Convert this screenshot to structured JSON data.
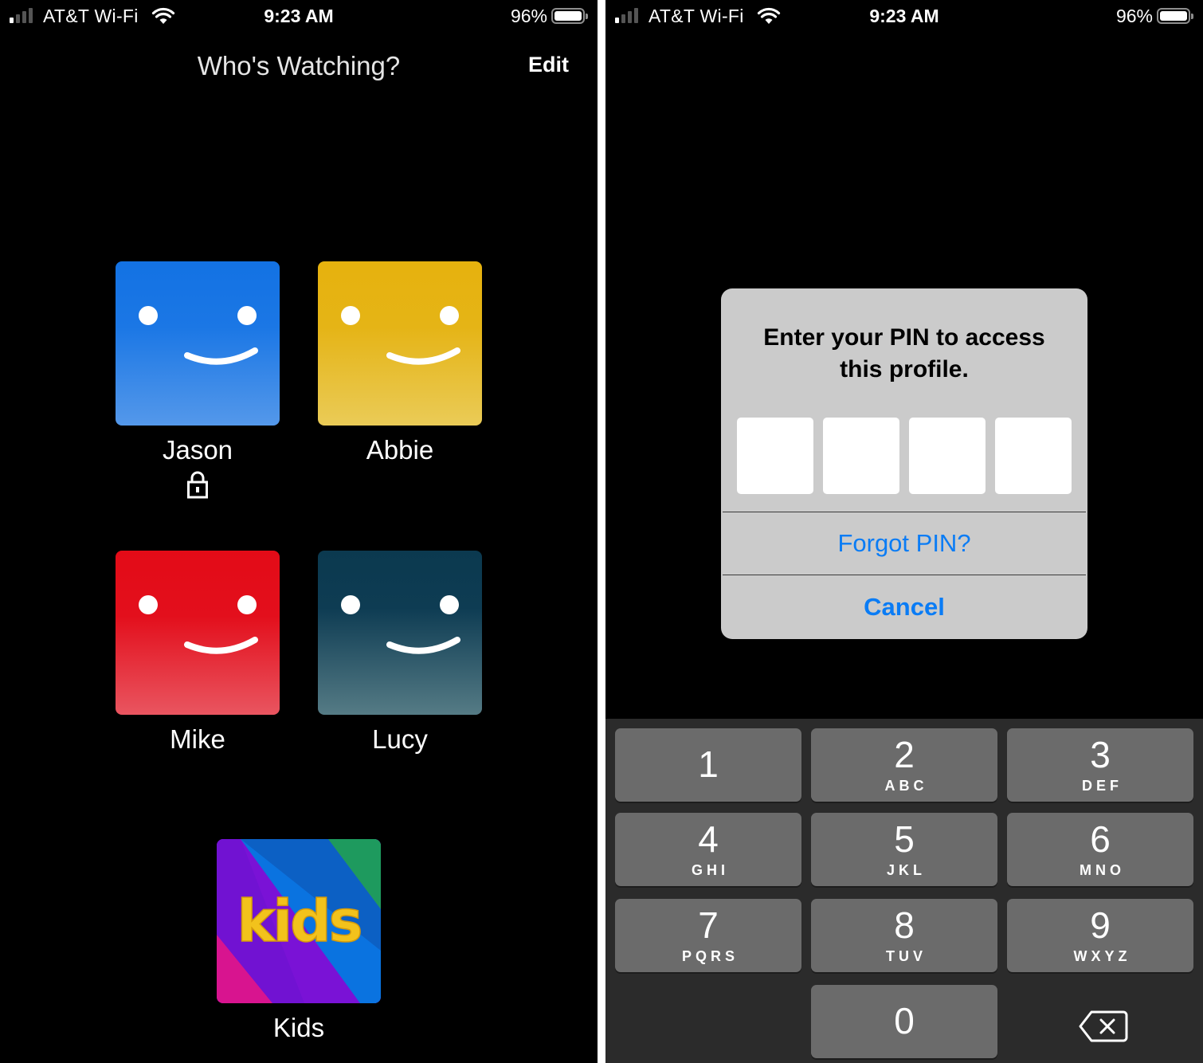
{
  "status_bar": {
    "carrier": "AT&T Wi-Fi",
    "time": "9:23 AM",
    "battery_percent": "96%",
    "battery_level": 0.96,
    "signal_bars": 1,
    "signal_bars_total": 4,
    "icons": [
      "signal-icon",
      "wifi-icon",
      "battery-icon"
    ]
  },
  "profiles_screen": {
    "title": "Who's Watching?",
    "edit_label": "Edit",
    "profiles": [
      {
        "name": "Jason",
        "color": "#1b77e5",
        "locked": true,
        "icon": "smiley-avatar"
      },
      {
        "name": "Abbie",
        "color": "#e5b416",
        "locked": false,
        "icon": "smiley-avatar"
      },
      {
        "name": "Mike",
        "color": "#e30f1c",
        "locked": false,
        "icon": "smiley-avatar"
      },
      {
        "name": "Lucy",
        "color": "#0e3c53",
        "locked": false,
        "icon": "smiley-avatar"
      },
      {
        "name": "Kids",
        "color": "#7c16d8",
        "locked": false,
        "icon": "kids-avatar",
        "avatar_text": "kids"
      }
    ]
  },
  "pin_screen": {
    "dialog": {
      "message_line1": "Enter your PIN to access",
      "message_line2": "this profile.",
      "pin_digits": [
        "",
        "",
        "",
        ""
      ],
      "forgot_label": "Forgot PIN?",
      "cancel_label": "Cancel",
      "accent_color": "#0a7cf5"
    },
    "keypad": [
      {
        "digit": "1",
        "letters": ""
      },
      {
        "digit": "2",
        "letters": "ABC"
      },
      {
        "digit": "3",
        "letters": "DEF"
      },
      {
        "digit": "4",
        "letters": "GHI"
      },
      {
        "digit": "5",
        "letters": "JKL"
      },
      {
        "digit": "6",
        "letters": "MNO"
      },
      {
        "digit": "7",
        "letters": "PQRS"
      },
      {
        "digit": "8",
        "letters": "TUV"
      },
      {
        "digit": "9",
        "letters": "WXYZ"
      },
      {
        "digit": "0",
        "letters": ""
      }
    ],
    "delete_icon": "backspace-icon"
  }
}
